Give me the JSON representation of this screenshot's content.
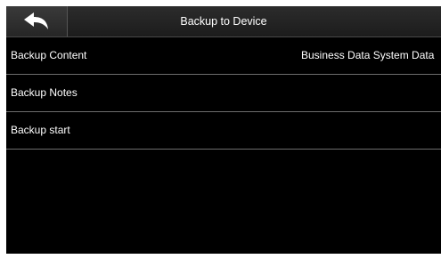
{
  "header": {
    "title": "Backup to Device",
    "back_icon": "back-arrow-icon"
  },
  "menu": {
    "items": [
      {
        "label": "Backup Content",
        "value": "Business Data System Data"
      },
      {
        "label": "Backup Notes"
      },
      {
        "label": "Backup start"
      }
    ]
  },
  "colors": {
    "background": "#000000",
    "header": "#262626",
    "text": "#ffffff",
    "divider": "#6e6e6e"
  }
}
